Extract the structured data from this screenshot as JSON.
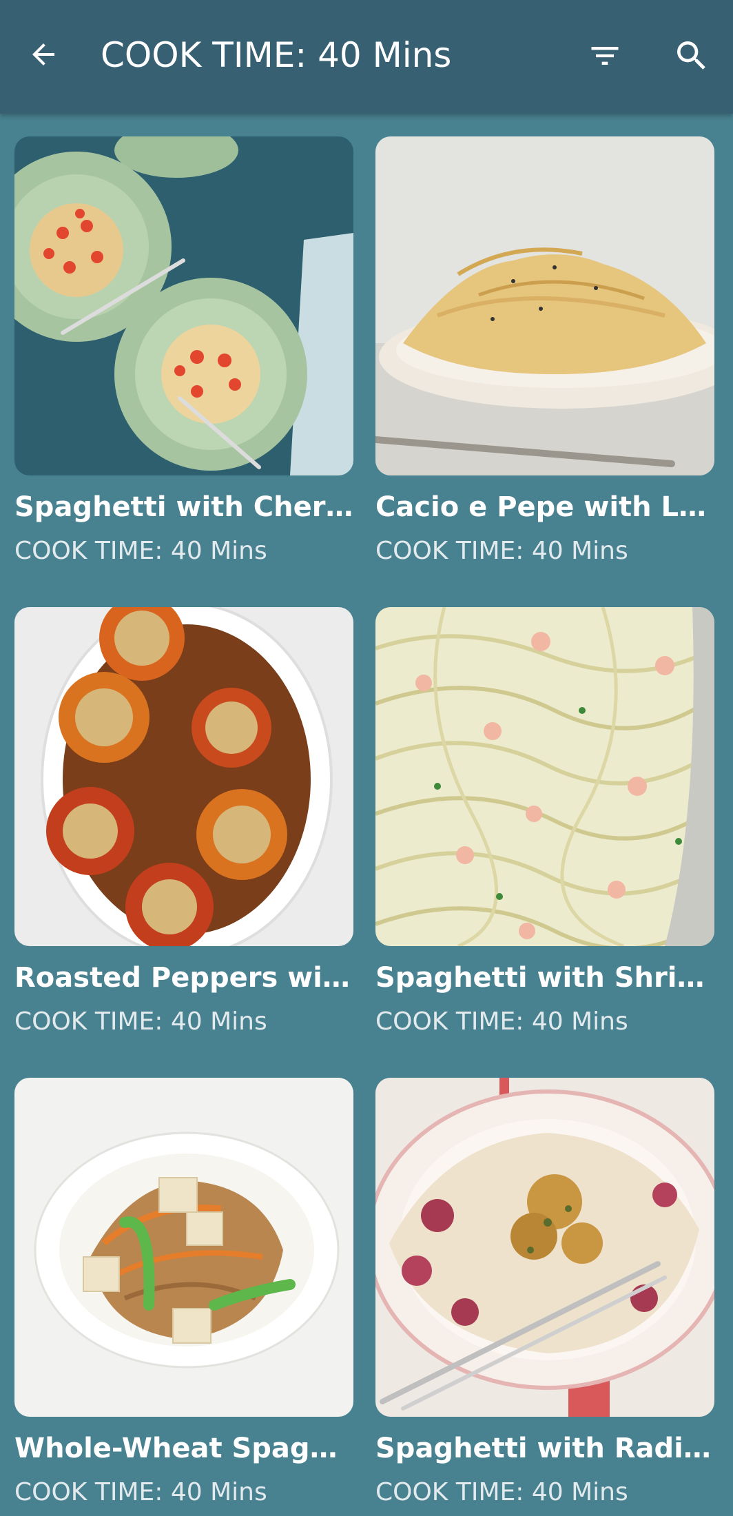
{
  "appbar": {
    "title": "COOK TIME: 40 Mins",
    "back_icon": "arrow-left-icon",
    "filter_icon": "filter-icon",
    "search_icon": "search-icon"
  },
  "colors": {
    "appbar": "#376073",
    "background": "#48818f",
    "text": "#ffffff"
  },
  "recipes": [
    {
      "name": "Spaghetti with Cherry ...",
      "cook_time": "COOK TIME: 40 Mins"
    },
    {
      "name": "Cacio e Pepe with Le...",
      "cook_time": "COOK TIME: 40 Mins"
    },
    {
      "name": "Roasted Peppers with ...",
      "cook_time": "COOK TIME: 40 Mins"
    },
    {
      "name": "Spaghetti with Shrimp...",
      "cook_time": "COOK TIME: 40 Mins"
    },
    {
      "name": "Whole-Wheat Spaghe...",
      "cook_time": "COOK TIME: 40 Mins"
    },
    {
      "name": "Spaghetti with Radicc...",
      "cook_time": "COOK TIME: 40 Mins"
    }
  ]
}
